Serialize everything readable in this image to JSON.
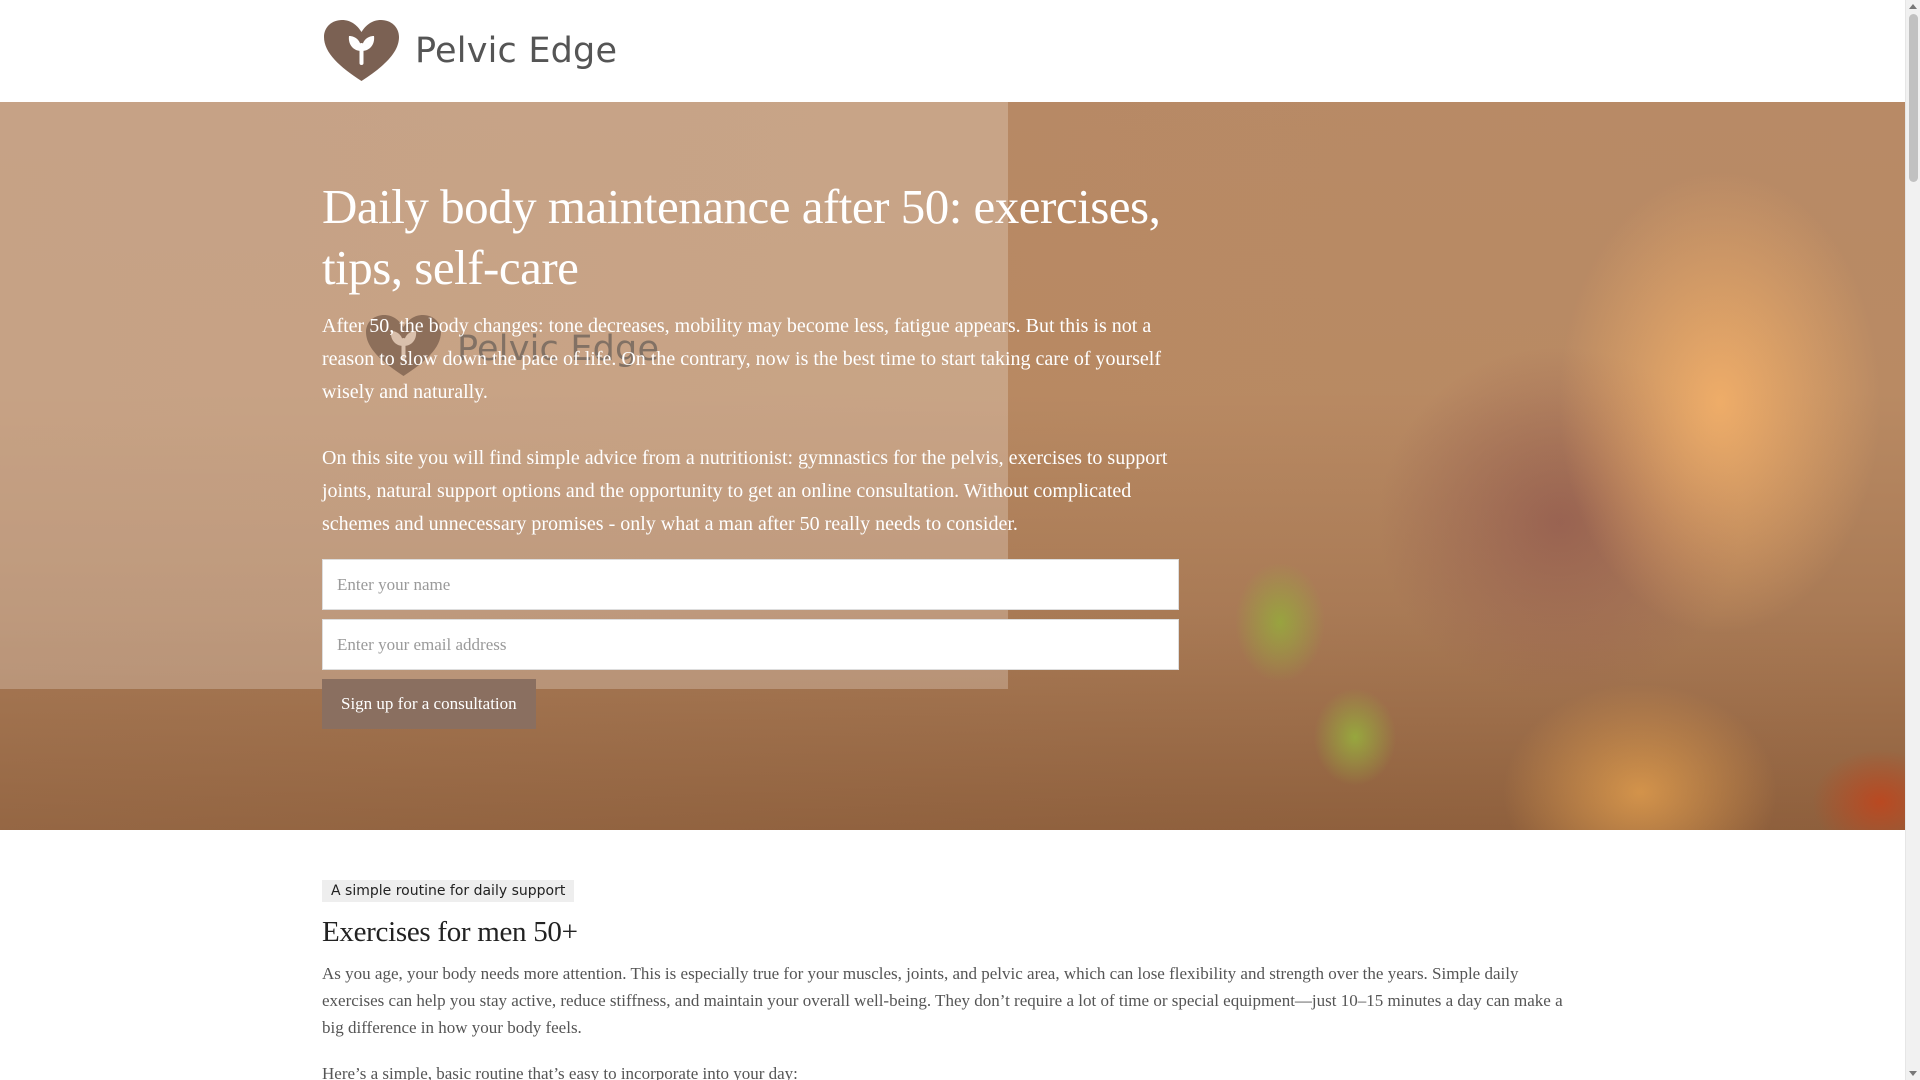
{
  "brand": {
    "name": "Pelvic Edge",
    "logo_icon": "heart-leaf-icon",
    "colors": {
      "logo": "#7b6153",
      "button": "#8a6f60"
    }
  },
  "hero": {
    "title": "Daily body maintenance after 50: exercises, tips, self-care",
    "paragraph1": "After 50, the body changes: tone decreases, mobility may become less, fatigue appears. But this is not a reason to slow down the pace of life. On the contrary, now is the best time to start taking care of yourself wisely and naturally.",
    "paragraph2": "On this site you will find simple advice from a nutritionist: gymnastics for the pelvis, exercises to support joints, natural support options and the opportunity to get an online consultation. Without complicated schemes and unnecessary promises - only what a man after 50 really needs to consider.",
    "form": {
      "name_placeholder": "Enter your name",
      "email_placeholder": "Enter your email address",
      "submit_label": "Sign up for a consultation"
    }
  },
  "section": {
    "badge": "A simple routine for daily support",
    "title": "Exercises for men 50+",
    "paragraph1": "As you age, your body needs more attention. This is especially true for your muscles, joints, and pelvic area, which can lose flexibility and strength over the years. Simple daily exercises can help you stay active, reduce stiffness, and maintain your overall well-being. They don’t require a lot of time or special equipment—just 10–15 minutes a day can make a big difference in how your body feels.",
    "paragraph2": "Here’s a simple, basic routine that’s easy to incorporate into your day:"
  }
}
